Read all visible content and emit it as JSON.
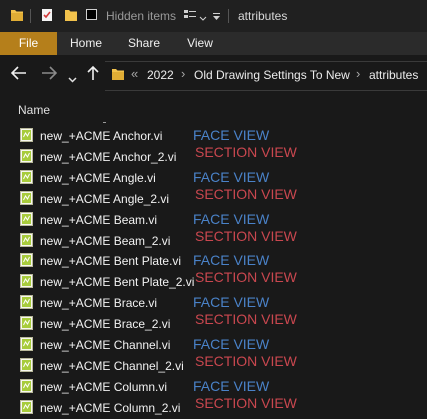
{
  "titlebar": {
    "hidden_items_label": "Hidden items",
    "title": "attributes"
  },
  "ribbon": {
    "tabs": [
      "File",
      "Home",
      "Share",
      "View"
    ]
  },
  "address": {
    "overflow": "«",
    "crumbs": [
      "2022",
      "Old Drawing Settings To New",
      "attributes"
    ],
    "separator": "›"
  },
  "list": {
    "column_header": "Name",
    "files": [
      {
        "name": "new_+ACME Anchor.vi"
      },
      {
        "name": "new_+ACME Anchor_2.vi"
      },
      {
        "name": "new_+ACME Angle.vi"
      },
      {
        "name": "new_+ACME Angle_2.vi"
      },
      {
        "name": "new_+ACME Beam.vi"
      },
      {
        "name": "new_+ACME Beam_2.vi"
      },
      {
        "name": "new_+ACME Bent Plate.vi"
      },
      {
        "name": "new_+ACME Bent Plate_2.vi"
      },
      {
        "name": "new_+ACME Brace.vi"
      },
      {
        "name": "new_+ACME Brace_2.vi"
      },
      {
        "name": "new_+ACME Channel.vi"
      },
      {
        "name": "new_+ACME Channel_2.vi"
      },
      {
        "name": "new_+ACME Column.vi"
      },
      {
        "name": "new_+ACME Column_2.vi"
      }
    ]
  },
  "annotations": {
    "face_label": "FACE VIEW",
    "section_label": "SECTION VIEW",
    "face_color": "#4a82c8",
    "section_color": "#c9474f"
  },
  "colors": {
    "file_tab": "#b57f1b",
    "folder": "#f2c24c"
  }
}
